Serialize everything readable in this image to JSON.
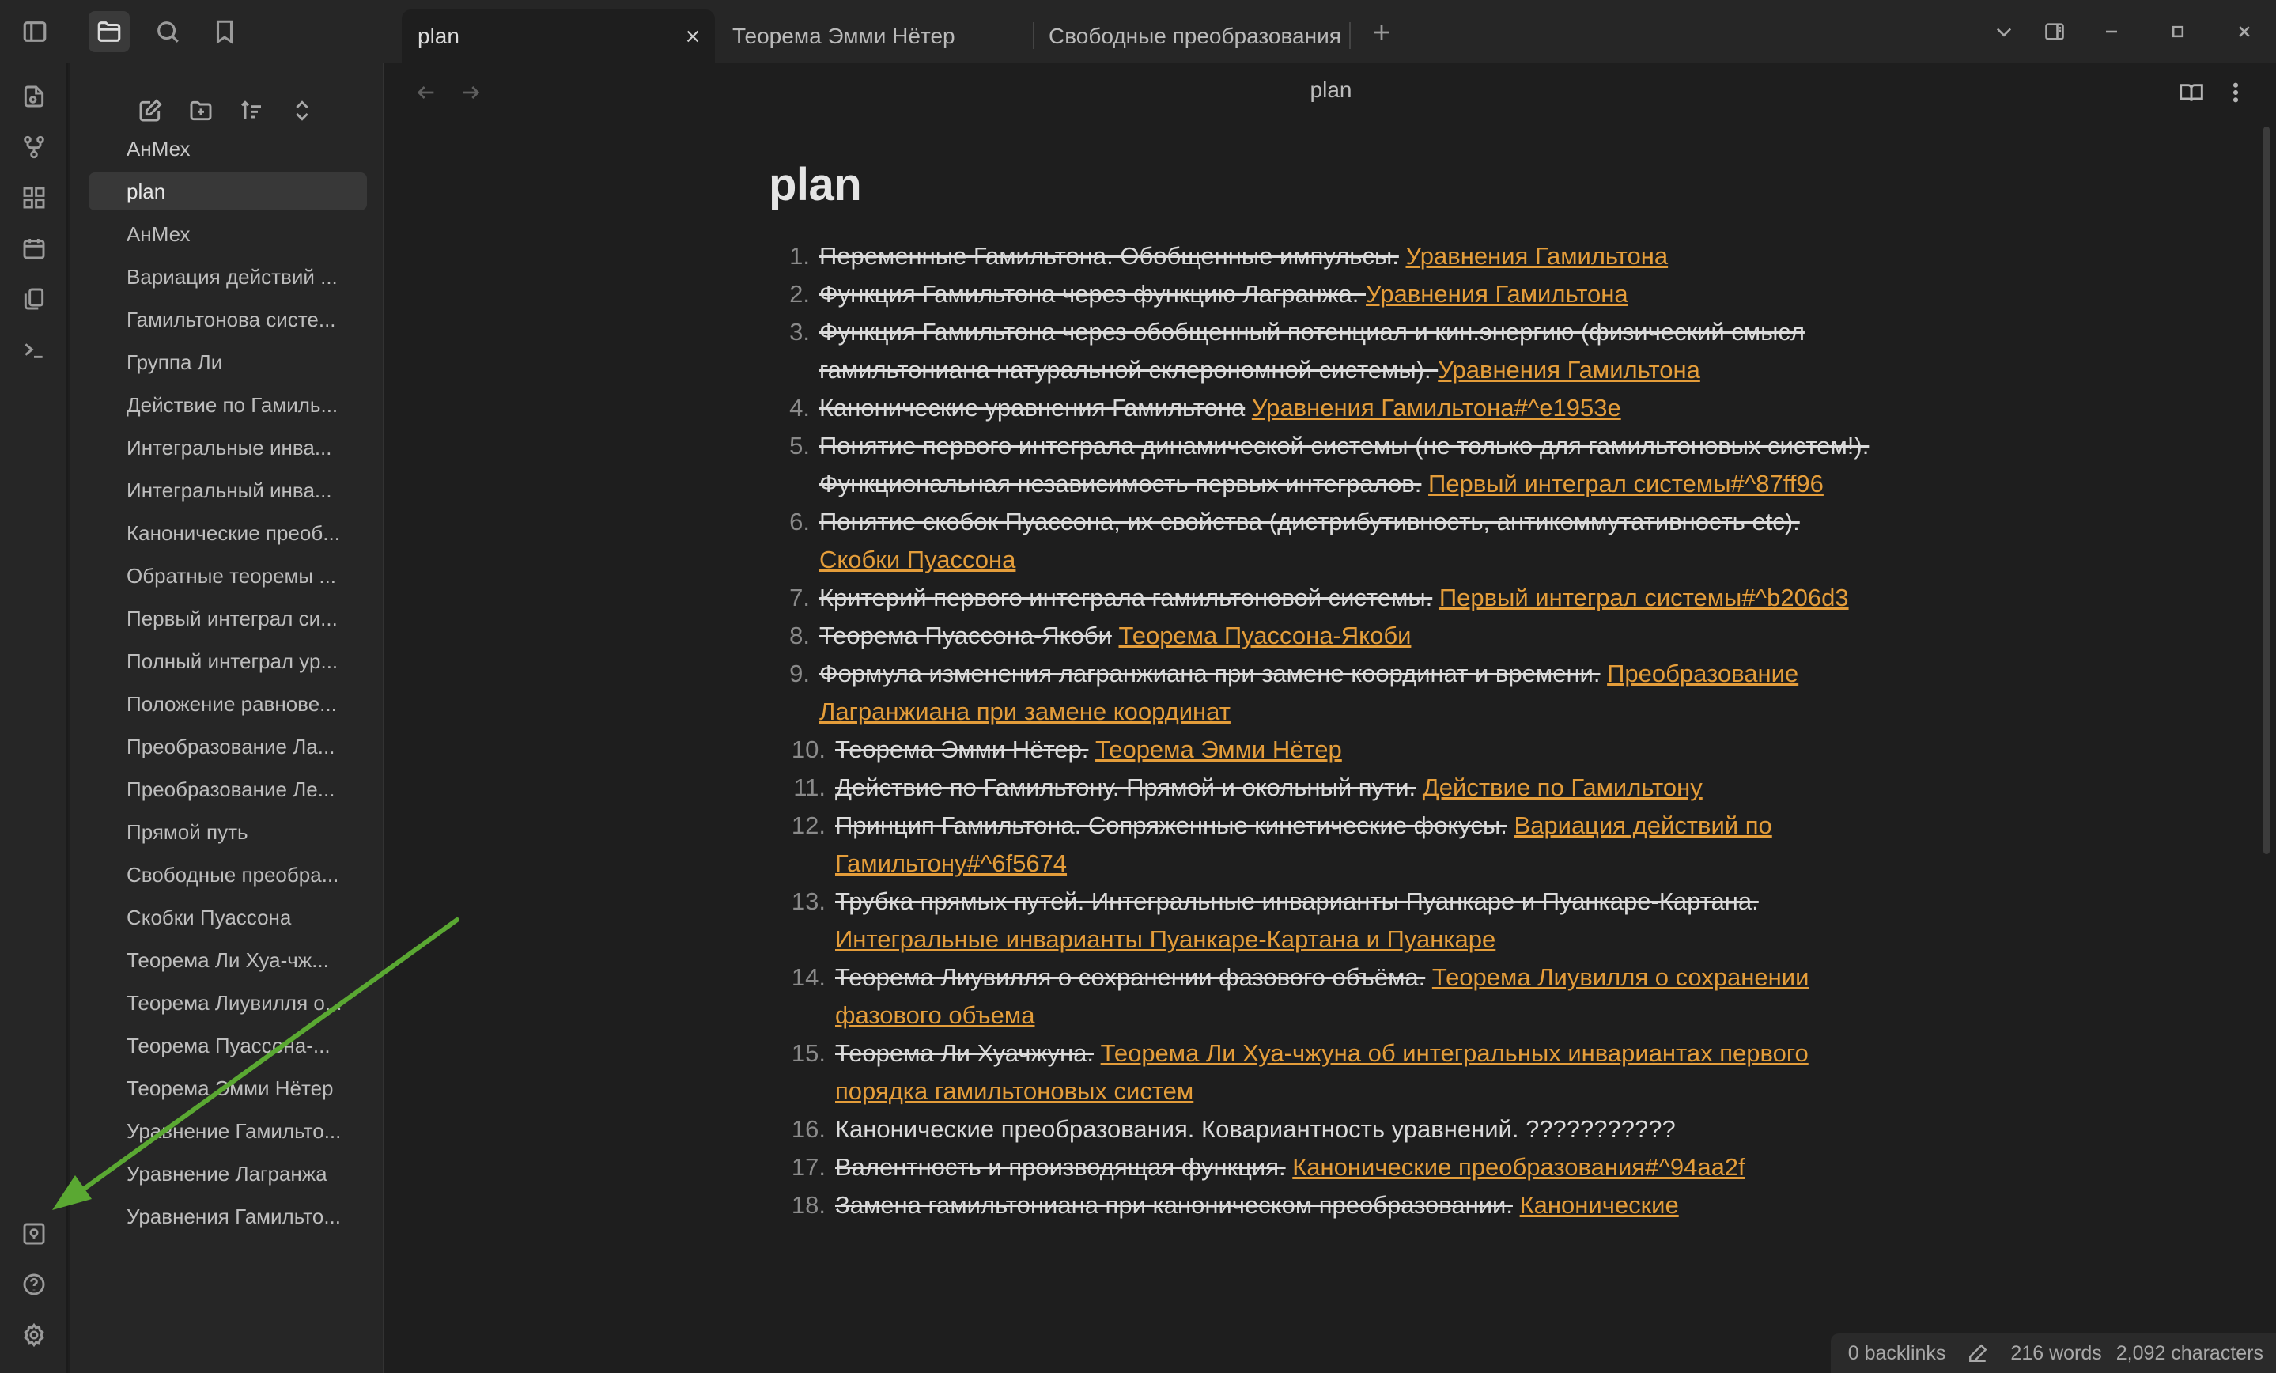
{
  "tabs": [
    {
      "label": "plan",
      "active": true
    },
    {
      "label": "Теорема Эмми Нётер",
      "active": false
    },
    {
      "label": "Свободные преобразования",
      "active": false
    }
  ],
  "explorer": {
    "files": [
      "АнМех",
      "plan",
      "АнМех",
      "Вариация действий ...",
      "Гамильтонова систе...",
      "Группа Ли",
      "Действие по Гамиль...",
      "Интегральные инва...",
      "Интегральный инва...",
      "Канонические преоб...",
      "Обратные теоремы ...",
      "Первый интеграл си...",
      "Полный интеграл ур...",
      "Положение равнове...",
      "Преобразование Ла...",
      "Преобразование Ле...",
      "Прямой путь",
      "Свободные преобра...",
      "Скобки Пуассона",
      "Теорема Ли Хуа-чж...",
      "Теорема Лиувилля о...",
      "Теорема Пуассона-...",
      "Теорема Эмми Нётер",
      "Уравнение Гамильто...",
      "Уравнение Лагранжа",
      "Уравнения Гамильто..."
    ],
    "active_index": 1
  },
  "view": {
    "header_title": "plan",
    "note_title": "plan"
  },
  "plan_items": [
    {
      "num": "1.",
      "strike": "Переменные Гамильтона. Обобщенные импульсы.",
      "link": "Уравнения Гамильтона"
    },
    {
      "num": "2.",
      "strike": "Функция Гамильтона через функцию Лагранжа. ",
      "link": "Уравнения Гамильтона"
    },
    {
      "num": "3.",
      "strike": "Функция Гамильтона через обобщенный потенциал и кин.энергию (физический смысл гамильтониана натуральной склерономной системы). ",
      "link": "Уравнения Гамильтона"
    },
    {
      "num": "4.",
      "strike": "Канонические уравнения Гамильтона",
      "link": "Уравнения Гамильтона#^e1953e"
    },
    {
      "num": "5.",
      "strike": "Понятие первого интеграла динамической системы (не только для гамильтоновых систем!). Функциональная независимость первых интегралов.",
      "link": "Первый интеграл системы#^87ff96"
    },
    {
      "num": "6.",
      "strike": "Понятие скобок Пуассона, их свойства (дистрибутивность, антикоммутативность etc).",
      "link": "Скобки Пуассона"
    },
    {
      "num": "7.",
      "strike": "Критерий первого интеграла гамильтоновой системы.",
      "link": "Первый интеграл системы#^b206d3"
    },
    {
      "num": "8.",
      "strike": "Теорема Пуассона-Якоби",
      "link": "Теорема Пуассона-Якоби"
    },
    {
      "num": "9.",
      "strike": "Формула изменения лагранжиана при замене координат и времени.",
      "link": "Преобразование Лагранжиана при замене координат"
    },
    {
      "num": "10.",
      "strike": "Теорема Эмми Нётер.",
      "link": "Теорема Эмми Нётер"
    },
    {
      "num": "11.",
      "strike": "Действие по Гамильтону. Прямой и окольный пути.",
      "link": "Действие по Гамильтону"
    },
    {
      "num": "12.",
      "strike": "Принцип Гамильтона. Сопряженные кинетические фокусы.",
      "link": "Вариация действий по Гамильтону#^6f5674"
    },
    {
      "num": "13.",
      "strike": "Трубка прямых путей. Интегральные инварианты Пуанкаре и Пуанкаре-Картана.",
      "link": "Интегральные инварианты Пуанкаре-Картана и Пуанкаре"
    },
    {
      "num": "14.",
      "strike": "Теорема Лиувилля о сохранении фазового объёма.",
      "link": "Теорема Лиувилля о сохранении фазового объема"
    },
    {
      "num": "15.",
      "strike": "Теорема Ли Хуачжуна.",
      "link": "Теорема Ли Хуа-чжуна об интегральных инвариантах первого порядка гамильтоновых систем"
    },
    {
      "num": "16.",
      "plain": "Канонические преобразования. Ковариантность уравнений. ???????????"
    },
    {
      "num": "17.",
      "strike": "Валентность и производящая функция.",
      "link": "Канонические преобразования#^94aa2f"
    },
    {
      "num": "18.",
      "strike": "Замена гамильтониана при каноническом преобразовании.",
      "link": "Канонические"
    }
  ],
  "status": {
    "backlinks": "0 backlinks",
    "words": "216 words",
    "characters": "2,092 characters"
  },
  "colors": {
    "accent_link": "#e49d3a",
    "annotation_arrow": "#5aa832"
  }
}
